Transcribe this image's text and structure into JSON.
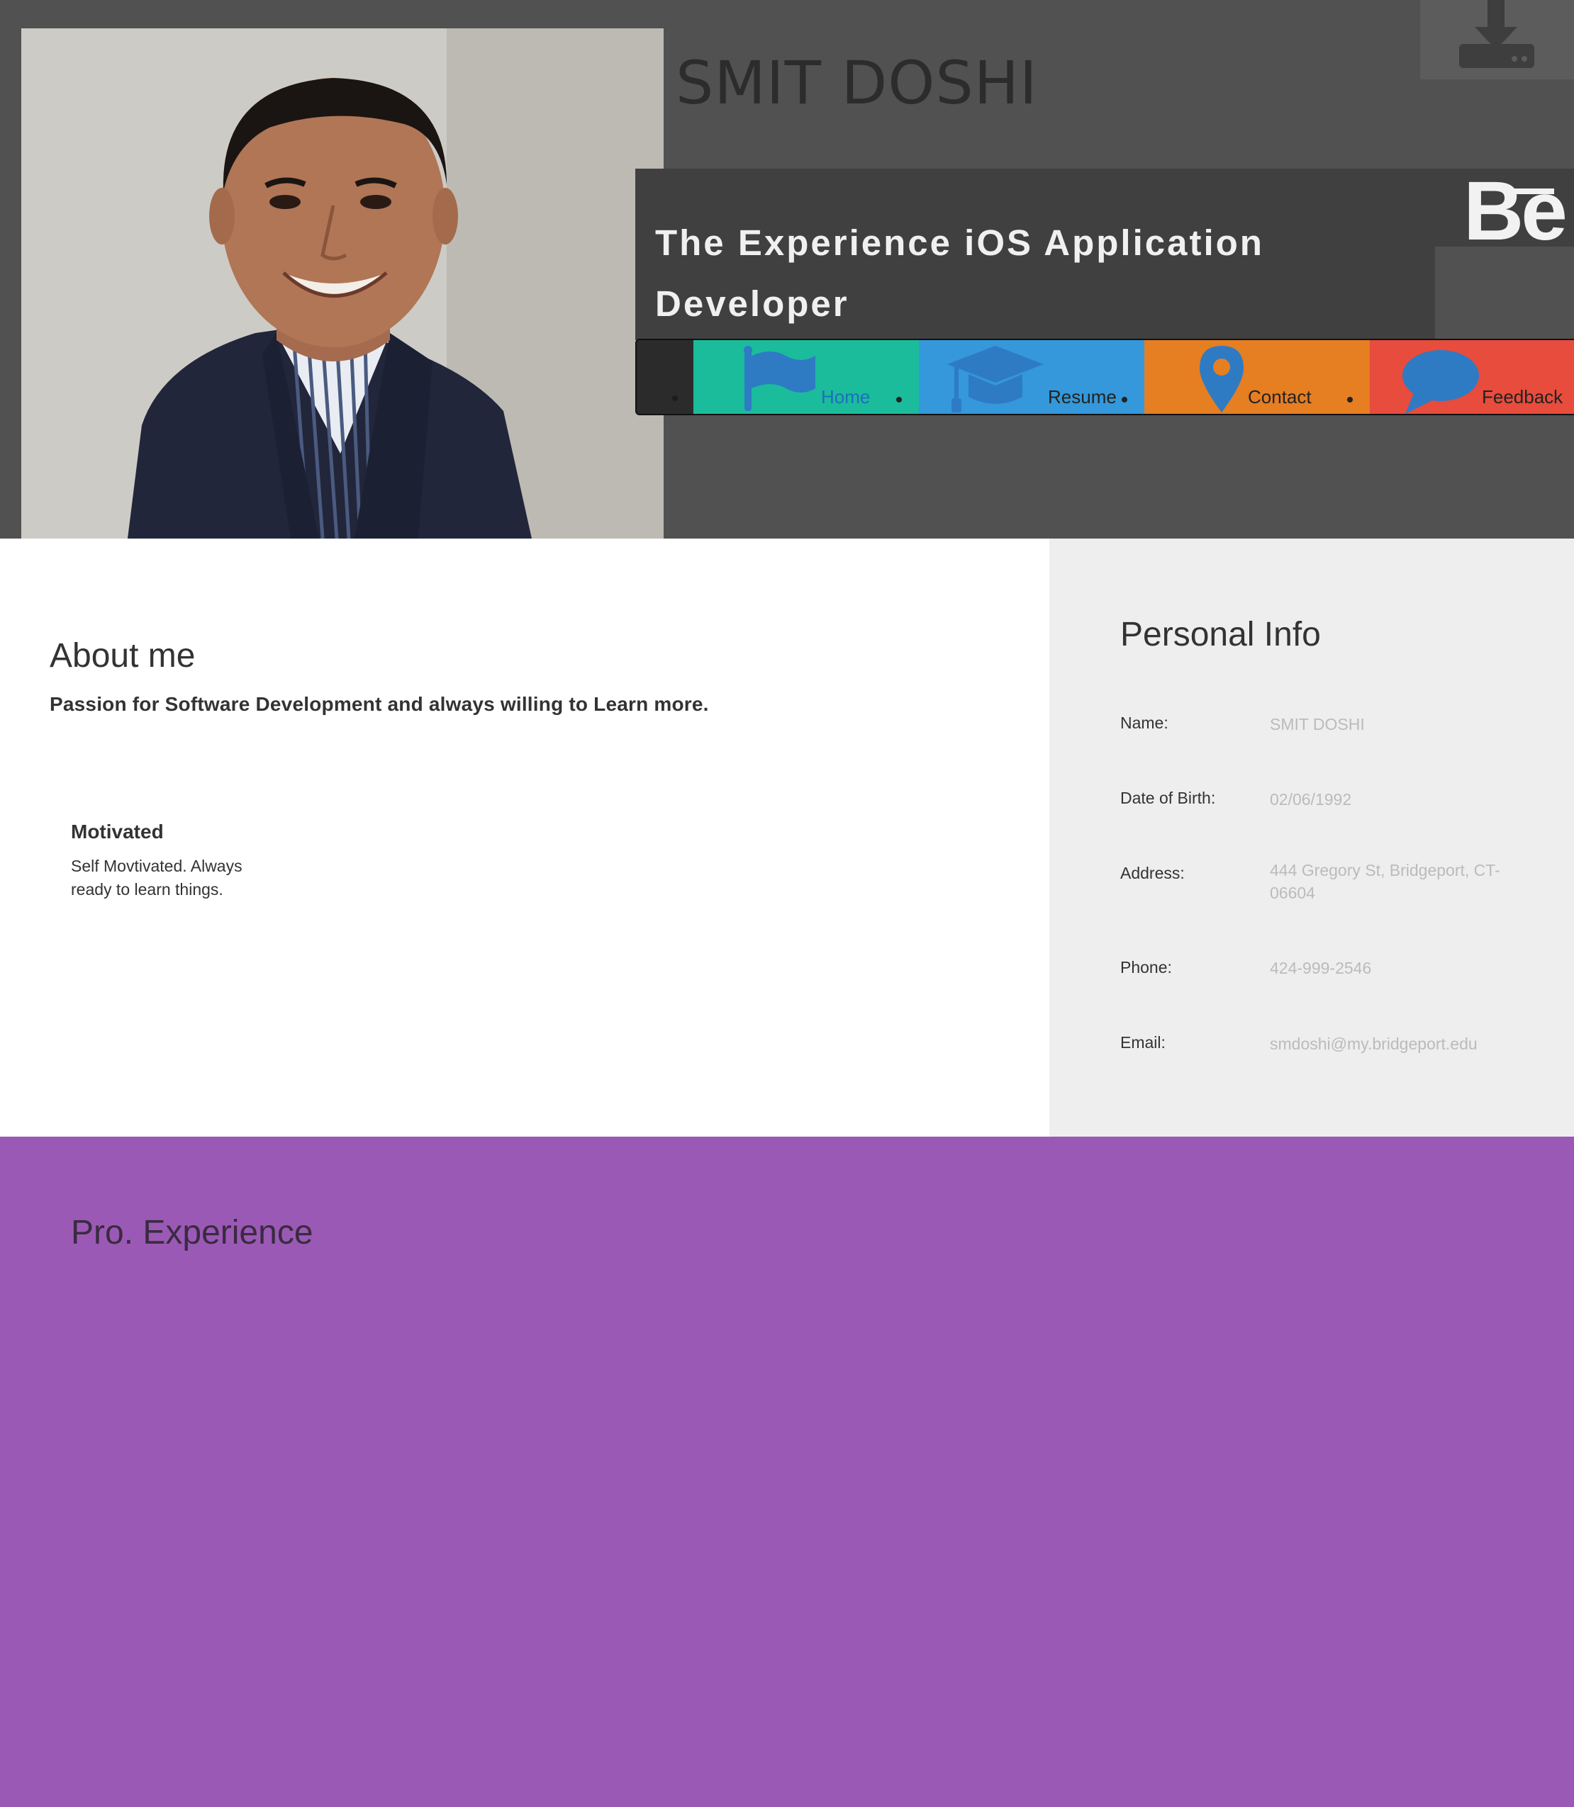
{
  "header": {
    "name": "SMIT DOSHI",
    "tagline": "The Experience iOS Application Developer",
    "behance_text": "Be"
  },
  "nav": {
    "items": [
      {
        "label": "Home",
        "icon": "flag-icon",
        "color": "#1abc9c"
      },
      {
        "label": "Resume",
        "icon": "graduation-cap-icon",
        "color": "#3498db"
      },
      {
        "label": "Contact",
        "icon": "map-marker-icon",
        "color": "#e67e22"
      },
      {
        "label": "Feedback",
        "icon": "speech-bubble-icon",
        "color": "#e74c3c"
      }
    ],
    "icon_color": "#2e7bc4"
  },
  "about": {
    "title": "About me",
    "subtitle": "Passion for Software Development and always willing to Learn more.",
    "trait": {
      "title": "Motivated",
      "text": "Self Movtivated. Always ready to learn things."
    }
  },
  "personal_info": {
    "title": "Personal Info",
    "fields": [
      {
        "label": "Name:",
        "value": "SMIT DOSHI"
      },
      {
        "label": "Date of Birth:",
        "value": "02/06/1992"
      },
      {
        "label": "Address:",
        "value": "444 Gregory St, Bridgeport, CT-06604"
      },
      {
        "label": "Phone:",
        "value": "424-999-2546"
      },
      {
        "label": "Email:",
        "value": "smdoshi@my.bridgeport.edu"
      }
    ]
  },
  "pro_experience": {
    "title": "Pro. Experience"
  },
  "colors": {
    "header_bg": "#515151",
    "tagline_bg": "#404040",
    "info_bg": "#eeeeee",
    "pro_bg": "#9b59b6"
  }
}
